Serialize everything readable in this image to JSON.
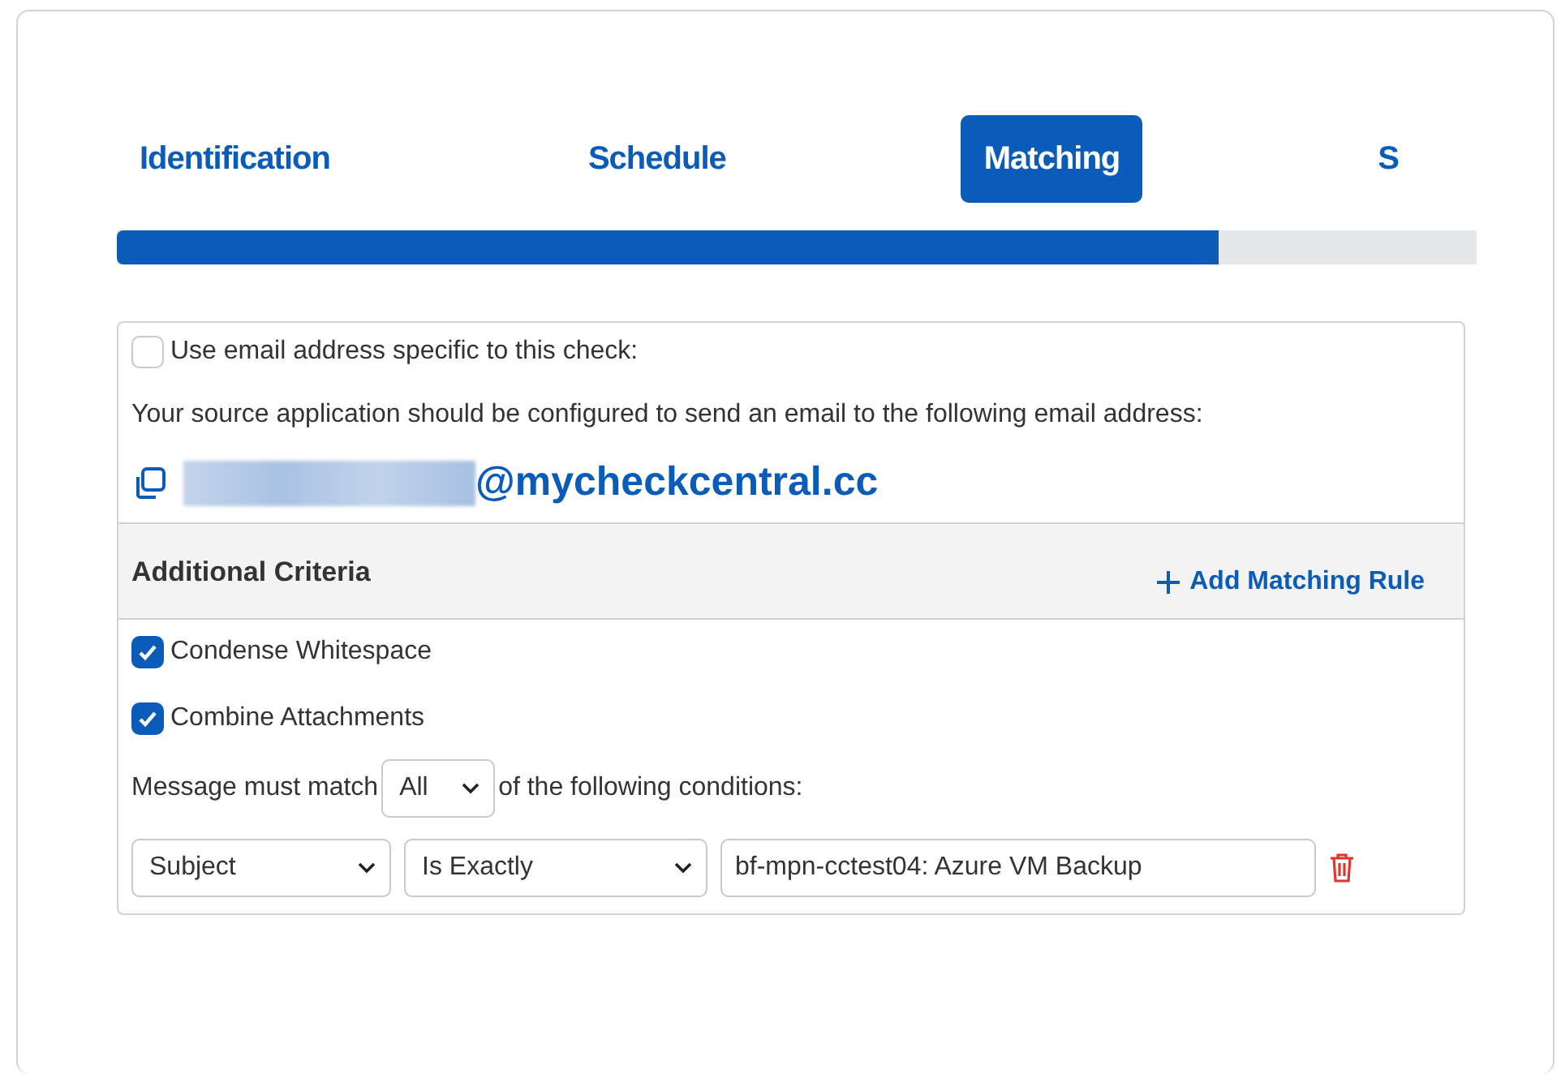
{
  "tabs": [
    {
      "label": "Identification",
      "selected": false
    },
    {
      "label": "Schedule",
      "selected": false
    },
    {
      "label": "Matching",
      "selected": true
    },
    {
      "label": "S",
      "selected": false
    }
  ],
  "progress": {
    "level": 0.81
  },
  "email_panel": {
    "specific_checkbox": {
      "label": "Use email address specific to this check:",
      "checked": false
    },
    "instruction": "Your source application should be configured to send an email to the following email address:",
    "email_domain": "@mycheckcentral.cc"
  },
  "criteria": {
    "title": "Additional Criteria",
    "add_rule_button": "Add Matching Rule",
    "options": [
      {
        "label": "Condense Whitespace",
        "checked": true
      },
      {
        "label": "Combine Attachments",
        "checked": true
      }
    ],
    "match_prefix": "Message must match",
    "match_mode": "All",
    "match_suffix": "of the following conditions:",
    "rules": [
      {
        "field": "Subject",
        "operator": "Is Exactly",
        "value": "bf-mpn-cctest04: Azure VM Backup"
      }
    ]
  }
}
